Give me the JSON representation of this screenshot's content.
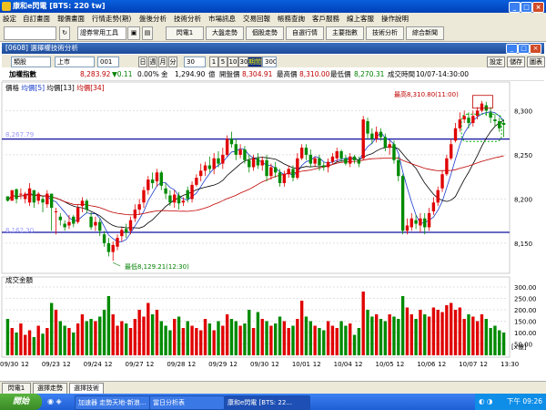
{
  "window": {
    "title": "康和e閃電 [BTS: 220 tw]"
  },
  "menu": [
    "設定",
    "自訂畫面",
    "報價畫面",
    "行情走勢(期)",
    "盤後分析",
    "技術分析",
    "市場訊息",
    "交易回報",
    "帳務查詢",
    "客戶服務",
    "線上客服",
    "操作說明"
  ],
  "toolbar": {
    "dropdown": "證券常用工具",
    "buttons": [
      "閃電1",
      "大盤走勢",
      "個股走勢",
      "自選行情",
      "主要指數",
      "技術分析",
      "綜合新聞"
    ]
  },
  "chart_window_title": "[0608] 選擇權技術分析",
  "controls": {
    "symbol": "類股",
    "market": "上市",
    "code": "001",
    "period_buttons": [
      "日",
      "週",
      "月",
      "分"
    ],
    "period_value": "30",
    "range_buttons": [
      "1",
      "5",
      "10",
      "30"
    ],
    "period_label": "期間",
    "period_count": "300",
    "right_buttons": [
      "設定",
      "儲存",
      "圖表"
    ]
  },
  "info": {
    "name": "加權指數",
    "last": "8,283.92",
    "change": "▼0.11",
    "pct": "0.00%",
    "amount_label": "金",
    "amount": "1,294.90",
    "amount_unit": "億",
    "open_label": "開盤價",
    "open": "8,304.91",
    "high_label": "最高價",
    "high": "8,310.00",
    "low_label": "最低價",
    "low": "8,270.31",
    "time_label": "成交時間",
    "time": "10/07-14:30:00"
  },
  "legend": {
    "label": "價格",
    "ma5": "均價[5]",
    "ma13": "均價[13]",
    "ma34": "均價[34]"
  },
  "annotations": {
    "high_note": "最高8,310.80(11:00)",
    "low_note": "最低8,129.21(12:30)",
    "line_upper": "8,267.79",
    "line_lower": "8,162.30",
    "vol_header": "成交金額",
    "vol_unit": "[x億]"
  },
  "chart_data": {
    "type": "candlestick",
    "ylim": [
      8120,
      8320
    ],
    "y_ticks": [
      8150,
      8200,
      8250,
      8300
    ],
    "y_tick_labels": [
      "8,150",
      "8,200",
      "8,250",
      "8,300"
    ],
    "vol_ylim": [
      0,
      320
    ],
    "vol_ticks": [
      50,
      100,
      150,
      200,
      250,
      300
    ],
    "vol_tick_labels": [
      "50.00",
      "100.00",
      "150.00",
      "200.00",
      "250.00",
      "300.00"
    ],
    "x_labels": [
      "09/30",
      "12",
      "09/23",
      "12",
      "09/24",
      "12",
      "09/27",
      "12",
      "09/28",
      "12",
      "09/29",
      "12",
      "09/30",
      "12",
      "10/01",
      "12",
      "10/04",
      "12",
      "10/05",
      "12",
      "10/06",
      "12",
      "10/07",
      "12",
      "13:30"
    ],
    "candles": [
      [
        8203,
        8198,
        8200,
        8197
      ],
      [
        8198,
        8210,
        8208,
        8205
      ],
      [
        8211,
        8200,
        8212,
        8195
      ],
      [
        8205,
        8206,
        8212,
        8200
      ],
      [
        8200,
        8206,
        8208,
        8195
      ],
      [
        8196,
        8212,
        8218,
        8192
      ],
      [
        8210,
        8196,
        8210,
        8190
      ],
      [
        8198,
        8206,
        8208,
        8194
      ],
      [
        8200,
        8196,
        8204,
        8185
      ],
      [
        8194,
        8206,
        8210,
        8190
      ],
      [
        8206,
        8190,
        8206,
        8164
      ],
      [
        8185,
        8186,
        8190,
        8160
      ],
      [
        8180,
        8176,
        8184,
        8170
      ],
      [
        8172,
        8168,
        8176,
        8164
      ],
      [
        8170,
        8174,
        8182,
        8166
      ],
      [
        8180,
        8172,
        8182,
        8168
      ],
      [
        8174,
        8190,
        8194,
        8172
      ],
      [
        8192,
        8198,
        8202,
        8185
      ],
      [
        8198,
        8188,
        8200,
        8184
      ],
      [
        8180,
        8168,
        8185,
        8165
      ],
      [
        8170,
        8174,
        8180,
        8164
      ],
      [
        8174,
        8164,
        8178,
        8158
      ],
      [
        8160,
        8150,
        8164,
        8146
      ],
      [
        8150,
        8140,
        8156,
        8135
      ],
      [
        8140,
        8148,
        8152,
        8130
      ],
      [
        8146,
        8156,
        8160,
        8142
      ],
      [
        8158,
        8165,
        8168,
        8152
      ],
      [
        8166,
        8162,
        8172,
        8156
      ],
      [
        8164,
        8176,
        8180,
        8160
      ],
      [
        8178,
        8188,
        8194,
        8174
      ],
      [
        8188,
        8194,
        8200,
        8182
      ],
      [
        8196,
        8210,
        8214,
        8190
      ],
      [
        8210,
        8222,
        8226,
        8205
      ],
      [
        8222,
        8218,
        8230,
        8212
      ],
      [
        8220,
        8230,
        8234,
        8214
      ],
      [
        8230,
        8215,
        8232,
        8210
      ],
      [
        8212,
        8206,
        8218,
        8200
      ],
      [
        8204,
        8196,
        8210,
        8192
      ],
      [
        8196,
        8205,
        8210,
        8190
      ],
      [
        8204,
        8195,
        8208,
        8188
      ],
      [
        8196,
        8198,
        8202,
        8192
      ],
      [
        8210,
        8200,
        8214,
        8196
      ],
      [
        8200,
        8216,
        8220,
        8196
      ],
      [
        8216,
        8224,
        8228,
        8214
      ],
      [
        8226,
        8232,
        8240,
        8220
      ],
      [
        8232,
        8238,
        8242,
        8226
      ],
      [
        8238,
        8234,
        8248,
        8230
      ],
      [
        8234,
        8246,
        8252,
        8228
      ],
      [
        8246,
        8240,
        8254,
        8236
      ],
      [
        8240,
        8250,
        8258,
        8234
      ],
      [
        8250,
        8268,
        8272,
        8248
      ],
      [
        8268,
        8262,
        8276,
        8258
      ],
      [
        8262,
        8250,
        8268,
        8244
      ],
      [
        8250,
        8256,
        8262,
        8246
      ],
      [
        8256,
        8244,
        8260,
        8240
      ],
      [
        8244,
        8236,
        8250,
        8230
      ],
      [
        8236,
        8246,
        8250,
        8232
      ],
      [
        8246,
        8238,
        8252,
        8234
      ],
      [
        8238,
        8244,
        8248,
        8232
      ],
      [
        8244,
        8226,
        8250,
        8220
      ],
      [
        8226,
        8236,
        8240,
        8222
      ],
      [
        8236,
        8230,
        8242,
        8224
      ],
      [
        8230,
        8218,
        8234,
        8214
      ],
      [
        8218,
        8228,
        8232,
        8214
      ],
      [
        8228,
        8234,
        8238,
        8224
      ],
      [
        8234,
        8224,
        8238,
        8220
      ],
      [
        8224,
        8246,
        8252,
        8222
      ],
      [
        8246,
        8258,
        8262,
        8244
      ],
      [
        8258,
        8250,
        8262,
        8244
      ],
      [
        8250,
        8240,
        8256,
        8236
      ],
      [
        8240,
        8246,
        8248,
        8236
      ],
      [
        8246,
        8238,
        8250,
        8232
      ],
      [
        8238,
        8236,
        8242,
        8232
      ],
      [
        8236,
        8242,
        8246,
        8230
      ],
      [
        8242,
        8248,
        8252,
        8240
      ],
      [
        8246,
        8254,
        8258,
        8242
      ],
      [
        8254,
        8246,
        8256,
        8242
      ],
      [
        8246,
        8240,
        8250,
        8238
      ],
      [
        8240,
        8248,
        8252,
        8236
      ],
      [
        8248,
        8244,
        8250,
        8240
      ],
      [
        8244,
        8240,
        8248,
        8236
      ],
      [
        8246,
        8290,
        8294,
        8244
      ],
      [
        8288,
        8274,
        8292,
        8268
      ],
      [
        8274,
        8268,
        8280,
        8262
      ],
      [
        8268,
        8276,
        8282,
        8264
      ],
      [
        8276,
        8270,
        8280,
        8266
      ],
      [
        8270,
        8258,
        8274,
        8254
      ],
      [
        8258,
        8262,
        8266,
        8250
      ],
      [
        8262,
        8244,
        8266,
        8240
      ],
      [
        8244,
        8226,
        8248,
        8220
      ],
      [
        8226,
        8164,
        8228,
        8160
      ],
      [
        8164,
        8170,
        8178,
        8160
      ],
      [
        8168,
        8178,
        8184,
        8164
      ],
      [
        8176,
        8172,
        8182,
        8166
      ],
      [
        8170,
        8178,
        8184,
        8162
      ],
      [
        8178,
        8168,
        8184,
        8160
      ],
      [
        8168,
        8184,
        8190,
        8164
      ],
      [
        8186,
        8196,
        8202,
        8182
      ],
      [
        8196,
        8210,
        8214,
        8192
      ],
      [
        8212,
        8228,
        8232,
        8208
      ],
      [
        8228,
        8246,
        8250,
        8226
      ],
      [
        8246,
        8262,
        8268,
        8244
      ],
      [
        8266,
        8280,
        8286,
        8264
      ],
      [
        8280,
        8290,
        8298,
        8276
      ],
      [
        8290,
        8294,
        8300,
        8286
      ],
      [
        8292,
        8286,
        8298,
        8280
      ],
      [
        8286,
        8294,
        8300,
        8282
      ],
      [
        8294,
        8300,
        8304,
        8290
      ],
      [
        8300,
        8308,
        8311,
        8298
      ],
      [
        8306,
        8300,
        8310,
        8294
      ],
      [
        8298,
        8292,
        8304,
        8286
      ],
      [
        8290,
        8288,
        8296,
        8282
      ],
      [
        8288,
        8280,
        8292,
        8276
      ],
      [
        8286,
        8284,
        8290,
        8270
      ]
    ],
    "volumes": [
      160,
      120,
      100,
      140,
      90,
      110,
      80,
      130,
      95,
      120,
      230,
      200,
      150,
      130,
      120,
      100,
      140,
      180,
      150,
      160,
      150,
      170,
      200,
      260,
      180,
      130,
      150,
      140,
      120,
      160,
      200,
      170,
      230,
      180,
      200,
      150,
      130,
      110,
      160,
      170,
      120,
      150,
      130,
      120,
      110,
      160,
      140,
      110,
      150,
      130,
      180,
      160,
      150,
      130,
      140,
      200,
      120,
      190,
      160,
      150,
      130,
      140,
      170,
      150,
      120,
      130,
      160,
      240,
      170,
      150,
      130,
      120,
      110,
      150,
      130,
      120,
      150,
      130,
      140,
      90,
      120,
      280,
      200,
      170,
      180,
      160,
      150,
      180,
      170,
      160,
      260,
      210,
      180,
      160,
      200,
      180,
      170,
      210,
      200,
      190,
      220,
      230,
      200,
      210,
      160,
      180,
      170,
      150,
      180,
      160,
      120,
      130,
      110,
      100
    ]
  },
  "bottom_tabs": [
    "閃電1",
    "選擇走勢",
    "選擇技術"
  ],
  "taskbar": {
    "start": "開始",
    "tasks": [
      "加速器 走勢天地-新浪...",
      "當日分析表",
      "康和e閃電 [BTS: 22..."
    ],
    "clock": "下午 09:26"
  }
}
